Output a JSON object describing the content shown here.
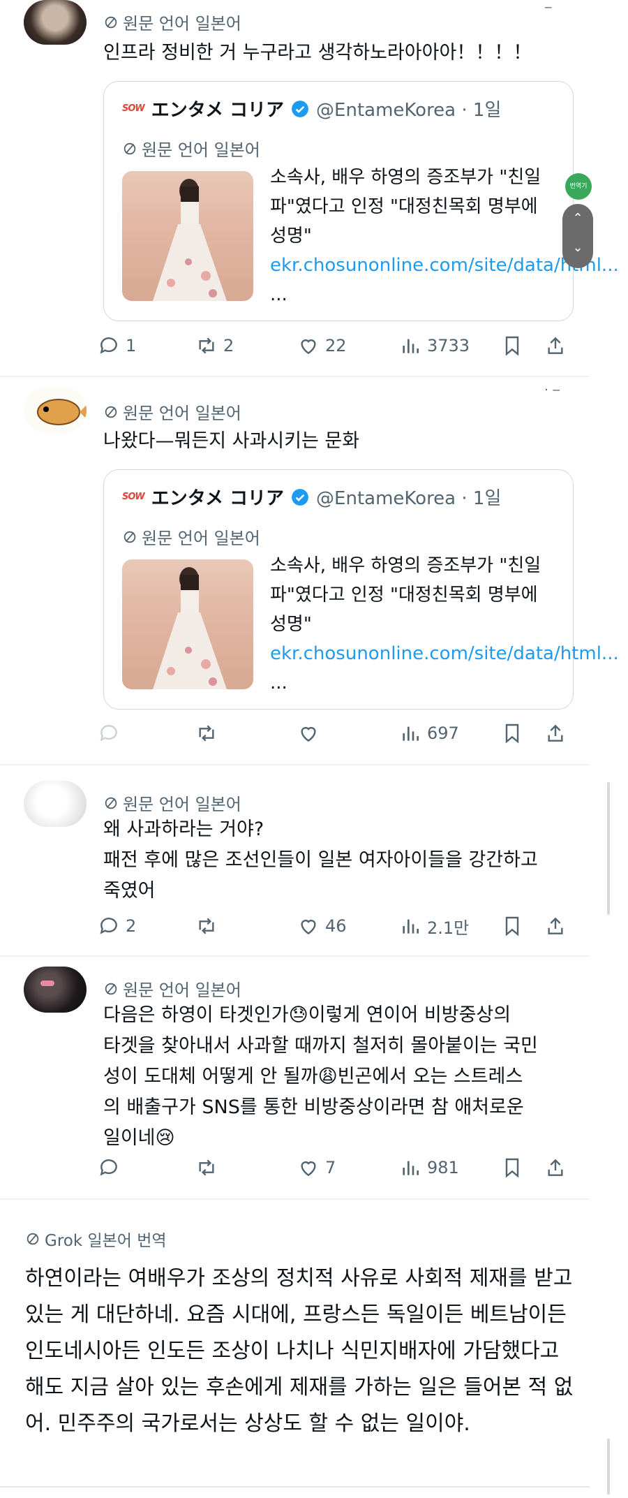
{
  "translate_label": "원문 언어 일본어",
  "tweets": [
    {
      "text": "인프라 정비한 거 누구라고 생각하노라아아아！！！！",
      "quote": true,
      "actions": {
        "reply": "1",
        "retweet": "2",
        "like": "22",
        "views": "3733"
      }
    },
    {
      "text": "나왔다—뭐든지 사과시키는 문화",
      "quote": true,
      "actions": {
        "reply": "",
        "retweet": "",
        "like": "",
        "views": "697"
      }
    },
    {
      "text": "왜 사과하라는 거야?\n패전 후에 많은 조선인들이 일본 여자아이들을 강간하고\n죽였어",
      "quote": false,
      "actions": {
        "reply": "2",
        "retweet": "",
        "like": "46",
        "views": "2.1만"
      }
    },
    {
      "text": "다음은 하영이 타겟인가😓이렇게 연이어 비방중상의\n타겟을 찾아내서 사과할 때까지 철저히 몰아붙이는 국민\n성이 도대체 어떻게 안 될까😩빈곤에서 오는 스트레스\n의 배출구가 SNS를 통한 비방중상이라면 참 애처로운\n일이네😢",
      "quote": false,
      "actions": {
        "reply": "",
        "retweet": "",
        "like": "7",
        "views": "981"
      }
    }
  ],
  "quoted": {
    "logo": "SOW",
    "name": "エンタメ コリア",
    "handle": "@EntameKorea · 1일",
    "translate_label": "원문 언어 일본어",
    "title": "소속사, 배우 하영의 증조부가 \"친일파\"였다고 인정 \"대정친목회 명부에 성명\"",
    "link": "ekr.chosunonline.com/site/data/html...",
    "link_suffix": " ..."
  },
  "grok": {
    "label": "Grok 일본어 번역",
    "text": "하연이라는 여배우가 조상의 정치적 사유로 사회적 제재를 받고 있는 게 대단하네. 요즘 시대에, 프랑스든 독일이든 베트남이든 인도네시아든 인도든 조상이 나치나 식민지배자에 가담했다고 해도 지금 살아 있는 후손에게 제재를 가하는 일은 들어본 적 없어. 민주주의 국가로서는 상상도 할 수 없는 일이야."
  },
  "overlay": {
    "badge": "번역기",
    "up": "⌃",
    "down": "⌄"
  },
  "colors": {
    "text": "#0f1419",
    "muted": "#536471",
    "link": "#1d9bf0",
    "verified": "#1d9bf0",
    "border": "#cfd9de"
  },
  "icons": [
    "translate-icon",
    "verified-icon",
    "reply-icon",
    "retweet-icon",
    "like-icon",
    "views-icon",
    "bookmark-icon",
    "share-icon"
  ]
}
